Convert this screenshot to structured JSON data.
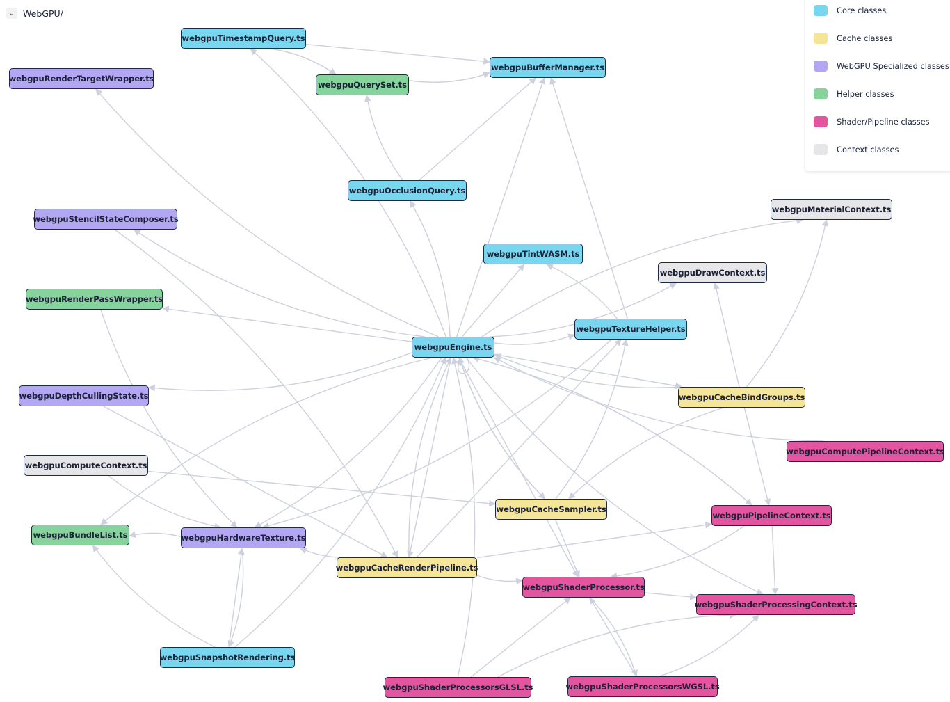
{
  "header": {
    "toggle_icon": "chevron-down-icon",
    "title": "WebGPU/"
  },
  "legend": [
    {
      "key": "core",
      "label": "Core classes",
      "color": "#79d6ef"
    },
    {
      "key": "cache",
      "label": "Cache classes",
      "color": "#f5e598"
    },
    {
      "key": "specialized",
      "label": "WebGPU Specialized classes",
      "color": "#b3a7f3"
    },
    {
      "key": "helper",
      "label": "Helper classes",
      "color": "#86d49c"
    },
    {
      "key": "shader",
      "label": "Shader/Pipeline classes",
      "color": "#e3559f"
    },
    {
      "key": "context",
      "label": "Context classes",
      "color": "#e6e6e8"
    }
  ],
  "style": {
    "edge_color": "#cdd1dd",
    "node_border": "#1c2a48"
  },
  "nodes": [
    {
      "id": "timestamp",
      "label": "webgpuTimestampQuery.ts",
      "category": "core"
    },
    {
      "id": "rtwrapper",
      "label": "webgpuRenderTargetWrapper.ts",
      "category": "specialized"
    },
    {
      "id": "queryset",
      "label": "webgpuQuerySet.ts",
      "category": "helper"
    },
    {
      "id": "buffermgr",
      "label": "webgpuBufferManager.ts",
      "category": "core"
    },
    {
      "id": "occlusion",
      "label": "webgpuOcclusionQuery.ts",
      "category": "core"
    },
    {
      "id": "stencil",
      "label": "webgpuStencilStateComposer.ts",
      "category": "specialized"
    },
    {
      "id": "material",
      "label": "webgpuMaterialContext.ts",
      "category": "context"
    },
    {
      "id": "tint",
      "label": "webgpuTintWASM.ts",
      "category": "core"
    },
    {
      "id": "drawctx",
      "label": "webgpuDrawContext.ts",
      "category": "context"
    },
    {
      "id": "rpwrapper",
      "label": "webgpuRenderPassWrapper.ts",
      "category": "helper"
    },
    {
      "id": "texhelper",
      "label": "webgpuTextureHelper.ts",
      "category": "core"
    },
    {
      "id": "engine",
      "label": "webgpuEngine.ts",
      "category": "core"
    },
    {
      "id": "depth",
      "label": "webgpuDepthCullingState.ts",
      "category": "specialized"
    },
    {
      "id": "bindgroups",
      "label": "webgpuCacheBindGroups.ts",
      "category": "cache"
    },
    {
      "id": "computepipe",
      "label": "webgpuComputePipelineContext.ts",
      "category": "shader"
    },
    {
      "id": "computectx",
      "label": "webgpuComputeContext.ts",
      "category": "context"
    },
    {
      "id": "sampler",
      "label": "webgpuCacheSampler.ts",
      "category": "cache"
    },
    {
      "id": "pipectx",
      "label": "webgpuPipelineContext.ts",
      "category": "shader"
    },
    {
      "id": "bundle",
      "label": "webgpuBundleList.ts",
      "category": "helper"
    },
    {
      "id": "hwtexture",
      "label": "webgpuHardwareTexture.ts",
      "category": "specialized"
    },
    {
      "id": "renderpipe",
      "label": "webgpuCacheRenderPipeline.ts",
      "category": "cache"
    },
    {
      "id": "shaderproc",
      "label": "webgpuShaderProcessor.ts",
      "category": "shader"
    },
    {
      "id": "shaderprocctx",
      "label": "webgpuShaderProcessingContext.ts",
      "category": "shader"
    },
    {
      "id": "snapshot",
      "label": "webgpuSnapshotRendering.ts",
      "category": "core"
    },
    {
      "id": "glsl",
      "label": "webgpuShaderProcessorsGLSL.ts",
      "category": "shader"
    },
    {
      "id": "wgsl",
      "label": "webgpuShaderProcessorsWGSL.ts",
      "category": "shader"
    }
  ],
  "edges": [
    [
      "timestamp",
      "queryset"
    ],
    [
      "timestamp",
      "buffermgr"
    ],
    [
      "queryset",
      "buffermgr"
    ],
    [
      "occlusion",
      "queryset"
    ],
    [
      "occlusion",
      "buffermgr"
    ],
    [
      "engine",
      "timestamp"
    ],
    [
      "engine",
      "rtwrapper"
    ],
    [
      "engine",
      "buffermgr"
    ],
    [
      "engine",
      "occlusion"
    ],
    [
      "engine",
      "stencil"
    ],
    [
      "engine",
      "tint"
    ],
    [
      "engine",
      "drawctx"
    ],
    [
      "engine",
      "material"
    ],
    [
      "engine",
      "rpwrapper"
    ],
    [
      "engine",
      "texhelper"
    ],
    [
      "engine",
      "depth"
    ],
    [
      "engine",
      "bindgroups"
    ],
    [
      "engine",
      "bundle"
    ],
    [
      "engine",
      "hwtexture"
    ],
    [
      "engine",
      "renderpipe"
    ],
    [
      "engine",
      "sampler"
    ],
    [
      "engine",
      "pipectx"
    ],
    [
      "engine",
      "shaderproc"
    ],
    [
      "engine",
      "shaderprocctx"
    ],
    [
      "engine",
      "engine"
    ],
    [
      "texhelper",
      "buffermgr"
    ],
    [
      "texhelper",
      "tint"
    ],
    [
      "texhelper",
      "hwtexture"
    ],
    [
      "bindgroups",
      "drawctx"
    ],
    [
      "bindgroups",
      "material"
    ],
    [
      "bindgroups",
      "engine"
    ],
    [
      "bindgroups",
      "pipectx"
    ],
    [
      "bindgroups",
      "sampler"
    ],
    [
      "computepipe",
      "engine"
    ],
    [
      "computectx",
      "sampler"
    ],
    [
      "computectx",
      "hwtexture"
    ],
    [
      "sampler",
      "engine"
    ],
    [
      "sampler",
      "shaderproc"
    ],
    [
      "sampler",
      "texhelper"
    ],
    [
      "pipectx",
      "shaderproc"
    ],
    [
      "pipectx",
      "shaderprocctx"
    ],
    [
      "pipectx",
      "engine"
    ],
    [
      "renderpipe",
      "hwtexture"
    ],
    [
      "renderpipe",
      "pipectx"
    ],
    [
      "renderpipe",
      "shaderproc"
    ],
    [
      "renderpipe",
      "engine"
    ],
    [
      "renderpipe",
      "texhelper"
    ],
    [
      "rpwrapper",
      "hwtexture"
    ],
    [
      "stencil",
      "renderpipe"
    ],
    [
      "depth",
      "renderpipe"
    ],
    [
      "hwtexture",
      "bundle"
    ],
    [
      "snapshot",
      "bundle"
    ],
    [
      "snapshot",
      "hwtexture"
    ],
    [
      "snapshot",
      "engine"
    ],
    [
      "hwtexture",
      "snapshot"
    ],
    [
      "glsl",
      "shaderproc"
    ],
    [
      "glsl",
      "engine"
    ],
    [
      "glsl",
      "shaderprocctx"
    ],
    [
      "wgsl",
      "shaderproc"
    ],
    [
      "wgsl",
      "shaderprocctx"
    ],
    [
      "shaderproc",
      "wgsl"
    ],
    [
      "shaderproc",
      "shaderprocctx"
    ]
  ]
}
